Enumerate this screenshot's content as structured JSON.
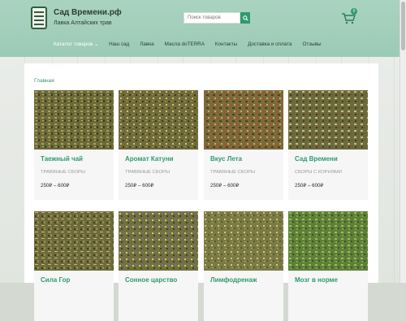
{
  "header": {
    "title": "Сад Времени.рф",
    "tagline": "Лавка Алтайских трав",
    "search_placeholder": "Поиск товаров",
    "cart_count": "0",
    "colors": {
      "accent": "#2f9a6d",
      "header_bg": "#a9d3c0"
    }
  },
  "nav": {
    "items": [
      {
        "label": "Каталог товаров ⌄"
      },
      {
        "label": "Наш сад"
      },
      {
        "label": "Лавка"
      },
      {
        "label": "Масла doTERRA"
      },
      {
        "label": "Контакты"
      },
      {
        "label": "Доставка и оплата"
      },
      {
        "label": "Отзывы"
      }
    ]
  },
  "breadcrumb": "Главная",
  "products": [
    {
      "name": "Таежный чай",
      "category": "Травяные сборы",
      "price": "250₽ – 600₽"
    },
    {
      "name": "Аромат Катуни",
      "category": "Травяные сборы",
      "price": "250₽ – 600₽"
    },
    {
      "name": "Вкус Лета",
      "category": "Травяные сборы",
      "price": "250₽ – 600₽"
    },
    {
      "name": "Сад Времени",
      "category": "Сборы с корнями",
      "price": "250₽ – 600₽"
    },
    {
      "name": "Сила Гор",
      "category": "",
      "price": ""
    },
    {
      "name": "Сонное царство",
      "category": "",
      "price": ""
    },
    {
      "name": "Лимфодренаж",
      "category": "",
      "price": ""
    },
    {
      "name": "Мозг в норме",
      "category": "",
      "price": ""
    }
  ]
}
